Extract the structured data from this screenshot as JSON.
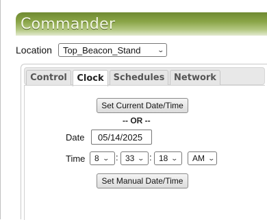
{
  "app": {
    "title": "Commander"
  },
  "location": {
    "label": "Location",
    "selected": "Top_Beacon_Stand"
  },
  "tabs": [
    {
      "label": "Control",
      "active": false
    },
    {
      "label": "Clock",
      "active": true
    },
    {
      "label": "Schedules",
      "active": false
    },
    {
      "label": "Network",
      "active": false
    }
  ],
  "clock": {
    "set_current_label": "Set Current Date/Time",
    "or_text": "-- OR --",
    "date_label": "Date",
    "date_value": "05/14/2025",
    "time_label": "Time",
    "hour": "8",
    "minute": "33",
    "second": "18",
    "ampm": "AM",
    "set_manual_label": "Set Manual Date/Time"
  },
  "colors": {
    "header_dark": "#6f8a32",
    "header_light": "#e3ead0",
    "title_text": "#f2f6e4"
  }
}
